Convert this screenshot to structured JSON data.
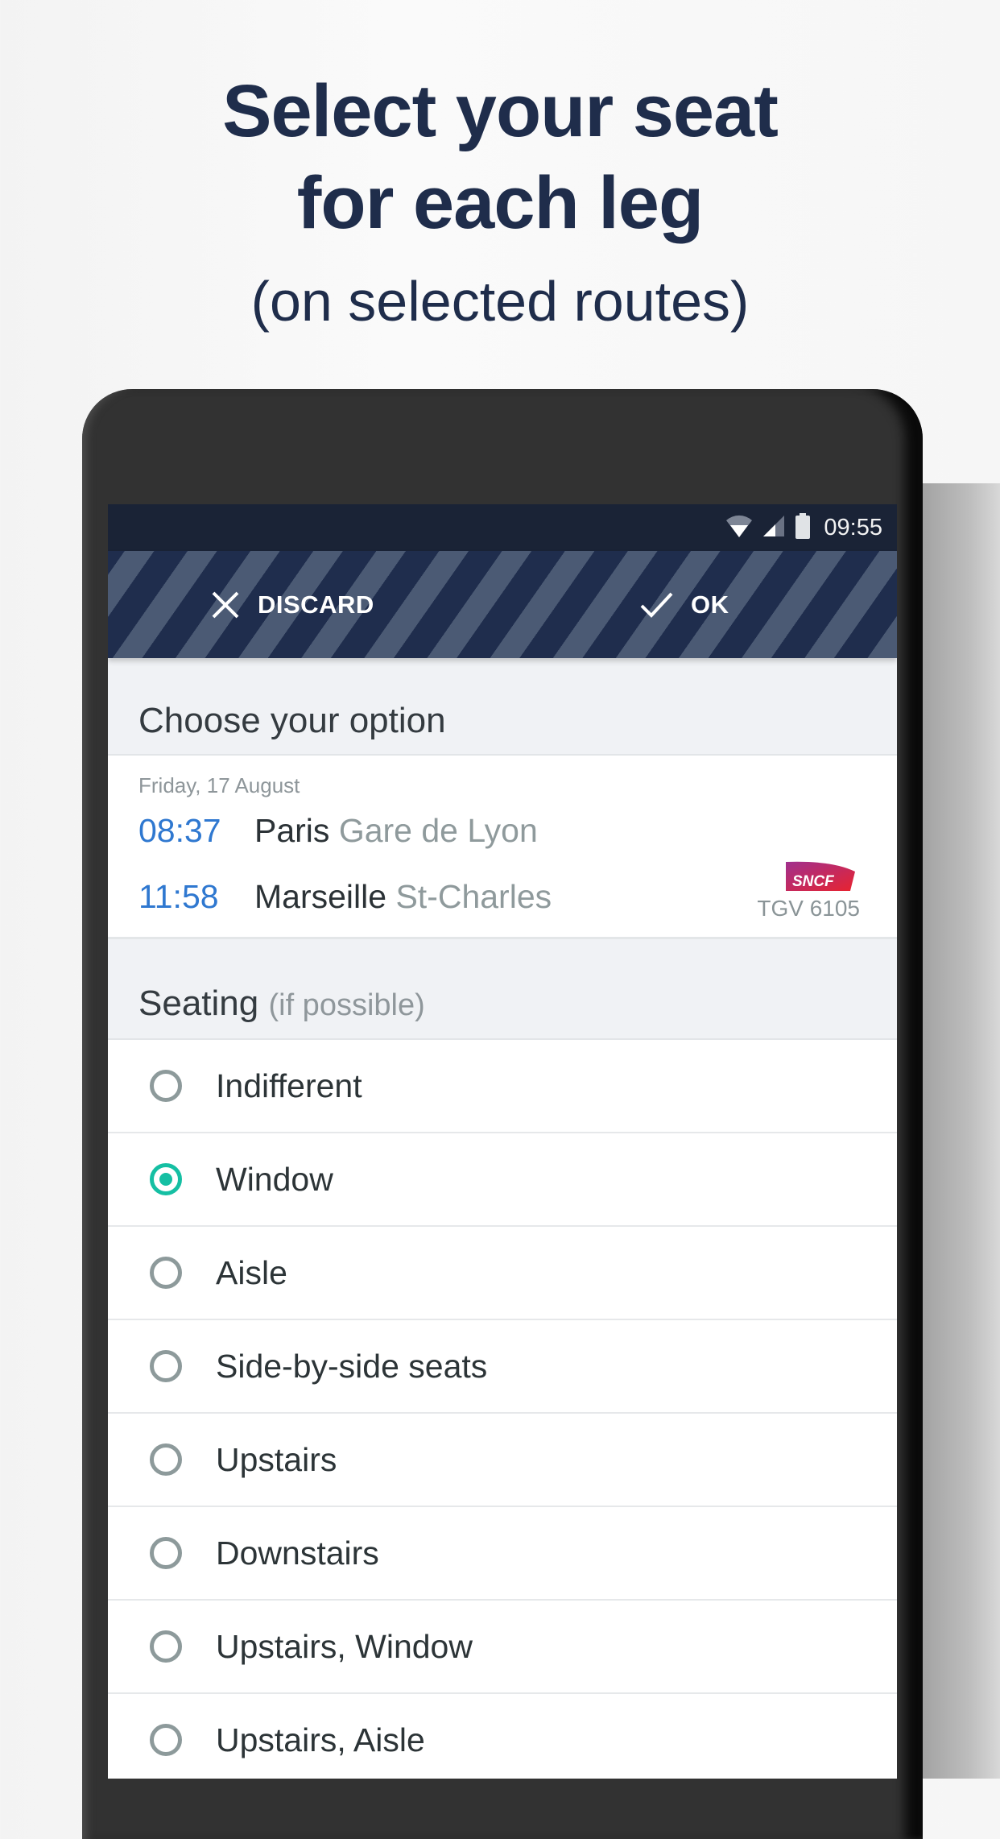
{
  "hero": {
    "line1": "Select your seat",
    "line2": "for each leg",
    "subtitle": "(on selected routes)"
  },
  "status_bar": {
    "time": "09:55",
    "icons": [
      "wifi-icon",
      "signal-icon",
      "battery-icon"
    ]
  },
  "toolbar": {
    "discard_label": "DISCARD",
    "ok_label": "OK"
  },
  "choose_section": {
    "title": "Choose your option"
  },
  "trip": {
    "date": "Friday, 17 August",
    "departure": {
      "time": "08:37",
      "city": "Paris",
      "station": "Gare de Lyon"
    },
    "arrival": {
      "time": "11:58",
      "city": "Marseille",
      "station": "St-Charles"
    },
    "operator_logo": "SNCF",
    "train_number": "TGV 6105"
  },
  "seating": {
    "title": "Seating",
    "hint": "(if possible)",
    "selected_index": 1,
    "options": [
      {
        "label": "Indifferent",
        "selected": false
      },
      {
        "label": "Window",
        "selected": true
      },
      {
        "label": "Aisle",
        "selected": false
      },
      {
        "label": "Side-by-side seats",
        "selected": false
      },
      {
        "label": "Upstairs",
        "selected": false
      },
      {
        "label": "Downstairs",
        "selected": false
      },
      {
        "label": "Upstairs, Window",
        "selected": false
      },
      {
        "label": "Upstairs, Aisle",
        "selected": false
      }
    ]
  },
  "colors": {
    "brand_navy": "#1f2d4b",
    "accent_teal": "#15bfa3",
    "time_blue": "#2f78d0"
  }
}
